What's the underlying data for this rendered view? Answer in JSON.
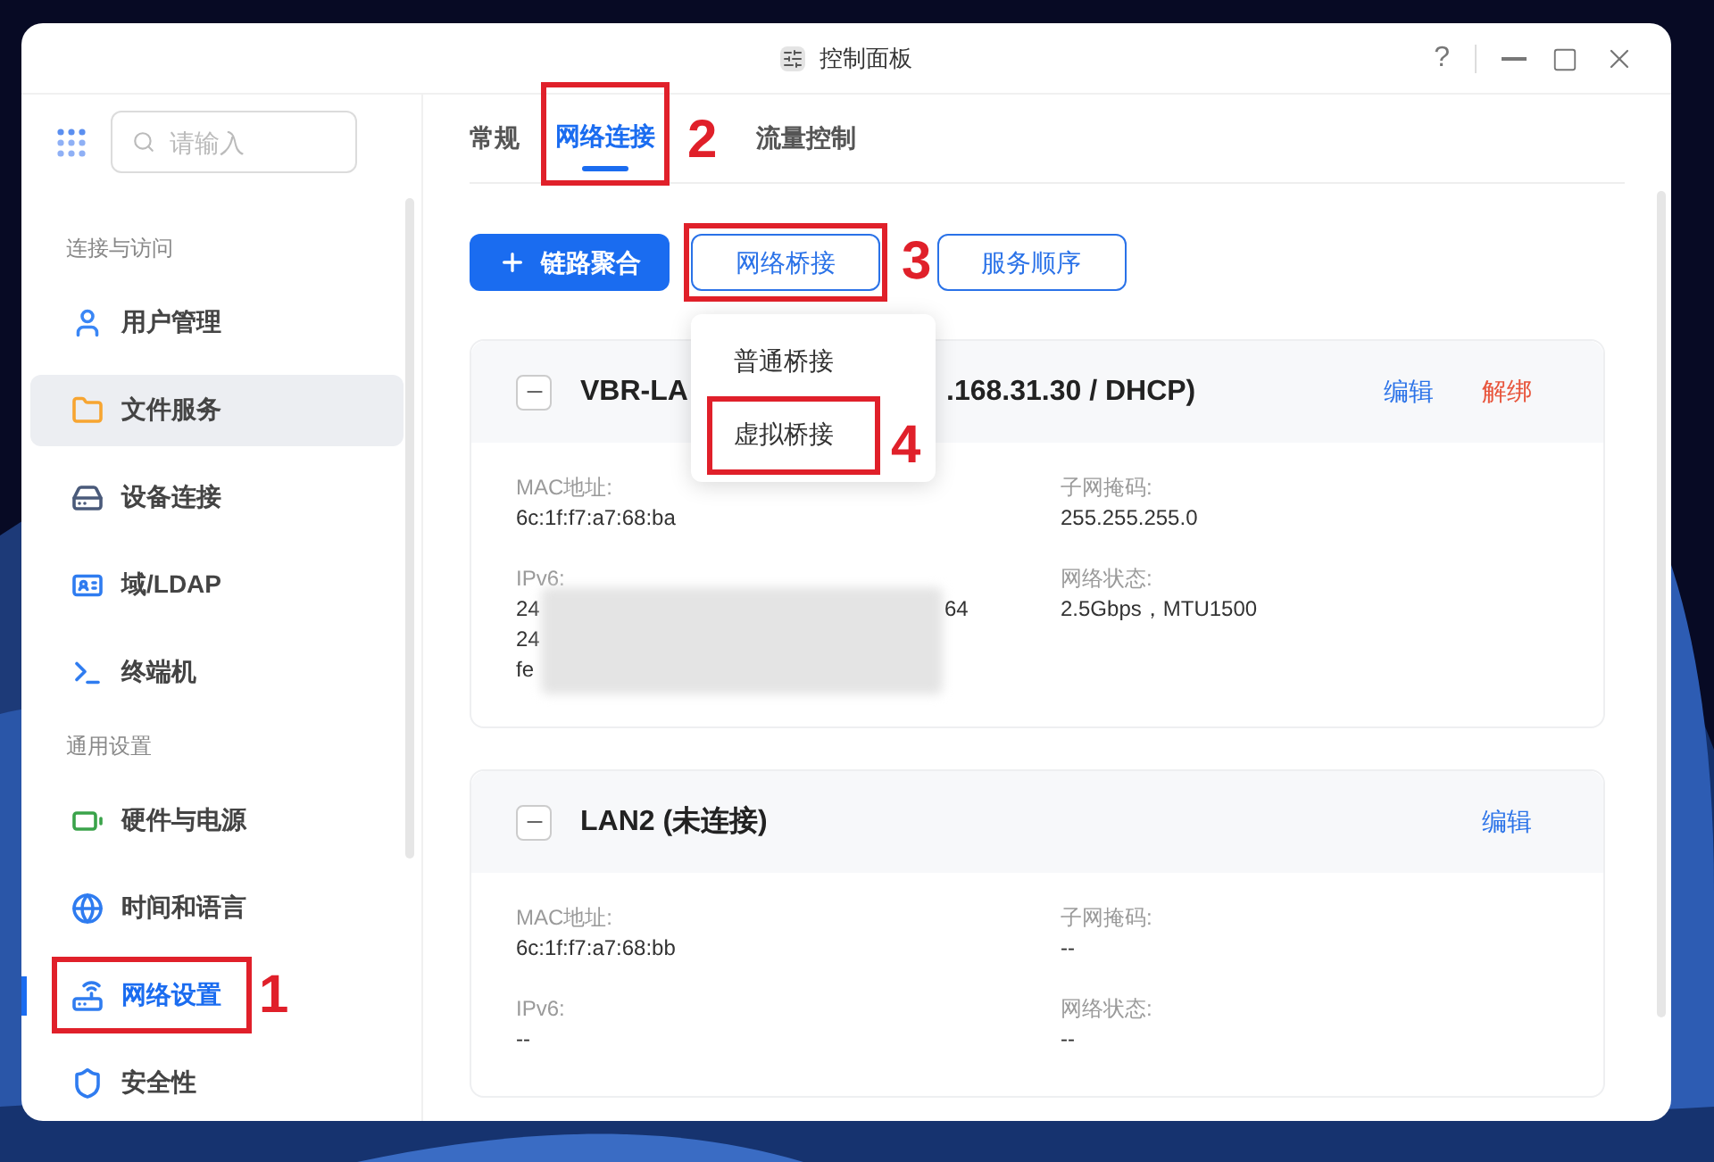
{
  "window": {
    "title": "控制面板",
    "help": "?"
  },
  "sidebar": {
    "search": {
      "placeholder": "请输入"
    },
    "sections": [
      {
        "title": "连接与访问",
        "items": [
          {
            "label": "用户管理",
            "selected": false,
            "hovered": false
          },
          {
            "label": "文件服务",
            "selected": false,
            "hovered": true
          },
          {
            "label": "设备连接",
            "selected": false,
            "hovered": false
          },
          {
            "label": "域/LDAP",
            "selected": false,
            "hovered": false
          },
          {
            "label": "终端机",
            "selected": false,
            "hovered": false
          }
        ]
      },
      {
        "title": "通用设置",
        "items": [
          {
            "label": "硬件与电源",
            "selected": false,
            "hovered": false
          },
          {
            "label": "时间和语言",
            "selected": false,
            "hovered": false
          },
          {
            "label": "网络设置",
            "selected": true,
            "hovered": false
          },
          {
            "label": "安全性",
            "selected": false,
            "hovered": false
          }
        ]
      }
    ]
  },
  "tabs": [
    {
      "label": "常规",
      "selected": false
    },
    {
      "label": "网络连接",
      "selected": true
    },
    {
      "label": "流量控制",
      "selected": false
    }
  ],
  "toolbar": [
    {
      "label": "链路聚合",
      "kind": "primary"
    },
    {
      "label": "网络桥接",
      "kind": "outline"
    },
    {
      "label": "服务顺序",
      "kind": "outline"
    }
  ],
  "bridge_menu": [
    {
      "label": "普通桥接"
    },
    {
      "label": "虚拟桥接"
    }
  ],
  "annotations": [
    "1",
    "2",
    "3",
    "4"
  ],
  "interfaces": [
    {
      "title": "VBR-LA",
      "title_after_menu": ".168.31.30 / DHCP)",
      "expanded": true,
      "actions": [
        {
          "label": "编辑",
          "kind": "edit"
        },
        {
          "label": "解绑",
          "kind": "unbind"
        }
      ],
      "left": [
        {
          "label": "MAC地址:",
          "values": [
            "6c:1f:f7:a7:68:ba"
          ]
        },
        {
          "label": "IPv6:",
          "values": [
            "24",
            "24",
            "fe"
          ],
          "redacted": true,
          "tail": "64"
        }
      ],
      "right": [
        {
          "label": "子网掩码:",
          "values": [
            "255.255.255.0"
          ]
        },
        {
          "label": "网络状态:",
          "values": [
            "2.5Gbps，MTU1500"
          ]
        }
      ]
    },
    {
      "title": "LAN2 (未连接)",
      "expanded": true,
      "actions": [
        {
          "label": "编辑",
          "kind": "edit"
        }
      ],
      "left": [
        {
          "label": "MAC地址:",
          "values": [
            "6c:1f:f7:a7:68:bb"
          ]
        },
        {
          "label": "IPv6:",
          "values": [
            "--"
          ]
        }
      ],
      "right": [
        {
          "label": "子网掩码:",
          "values": [
            "--"
          ]
        },
        {
          "label": "网络状态:",
          "values": [
            "--"
          ]
        }
      ]
    }
  ]
}
